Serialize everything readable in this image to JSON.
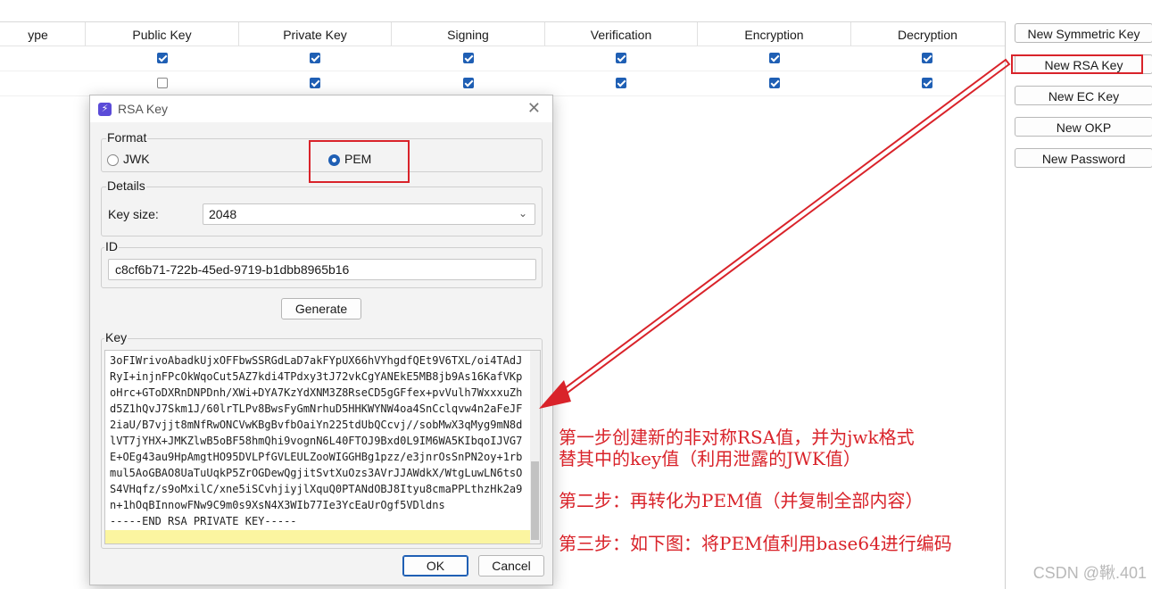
{
  "table": {
    "headers": [
      "ype",
      "Public Key",
      "Private Key",
      "Signing",
      "Verification",
      "Encryption",
      "Decryption"
    ],
    "rows": [
      [
        true,
        true,
        true,
        true,
        true,
        true
      ],
      [
        false,
        true,
        true,
        true,
        true,
        true
      ]
    ]
  },
  "side_buttons": [
    "New Symmetric Key",
    "New RSA Key",
    "New EC Key",
    "New OKP",
    "New Password"
  ],
  "dialog": {
    "title": "RSA Key",
    "format_label": "Format",
    "format_options": [
      "JWK",
      "PEM"
    ],
    "selected_format": "PEM",
    "details_label": "Details",
    "key_size_label": "Key size:",
    "key_size_value": "2048",
    "id_label": "ID",
    "id_value": "c8cf6b71-722b-45ed-9719-b1dbb8965b16",
    "generate_label": "Generate",
    "key_label": "Key",
    "key_lines": [
      "3oFIWrivoAbadkUjxOFFbwSSRGdLaD7akFYpUX66hVYhgdfQEt9V6TXL/oi4TAdJ",
      "RyI+injnFPcOkWqoCut5AZ7kdi4TPdxy3tJ72vkCgYANEkE5MB8jb9As16KafVKp",
      "oHrc+GToDXRnDNPDnh/XWi+DYA7KzYdXNM3Z8RseCD5gGFfex+pvVulh7WxxxuZh",
      "d5Z1hQvJ7Skm1J/60lrTLPv8BwsFyGmNrhuD5HHKWYNW4oa4SnCclqvw4n2aFeJF",
      "2iaU/B7vjjt8mNfRwONCVwKBgBvfbOaiYn225tdUbQCcvj//sobMwX3qMyg9mN8d",
      "lVT7jYHX+JMKZlwB5oBF58hmQhi9vognN6L40FTOJ9Bxd0L9IM6WA5KIbqoIJVG7",
      "E+OEg43au9HpAmgtHO95DVLPfGVLEULZooWIGGHBg1pzz/e3jnrOsSnPN2oy+1rb",
      "mul5AoGBAO8UaTuUqkP5ZrOGDewQgjitSvtXuOzs3AVrJJAWdkX/WtgLuwLN6tsO",
      "S4VHqfz/s9oMxilC/xne5iSCvhjiyjlXquQ0PTANdOBJ8Ityu8cmaPPLthzHk2a9",
      "n+1hOqBInnowFNw9C9m0s9XsN4X3WIb77Ie3YcEaUrOgf5VDldns",
      "-----END RSA PRIVATE KEY-----"
    ],
    "ok_label": "OK",
    "cancel_label": "Cancel"
  },
  "annotations": {
    "step1_line1": "第一步创建新的非对称RSA值，并为jwk格式",
    "step1_line2": "替其中的key值（利用泄露的JWK值）",
    "step2": "第二步：再转化为PEM值（并复制全部内容）",
    "step3": "第三步：如下图：将PEM值利用base64进行编码",
    "color": "#d9232a"
  },
  "watermark": "CSDN @鞦.401",
  "colors": {
    "accent": "#1f5fb4",
    "highlight": "#fbf5a0"
  }
}
